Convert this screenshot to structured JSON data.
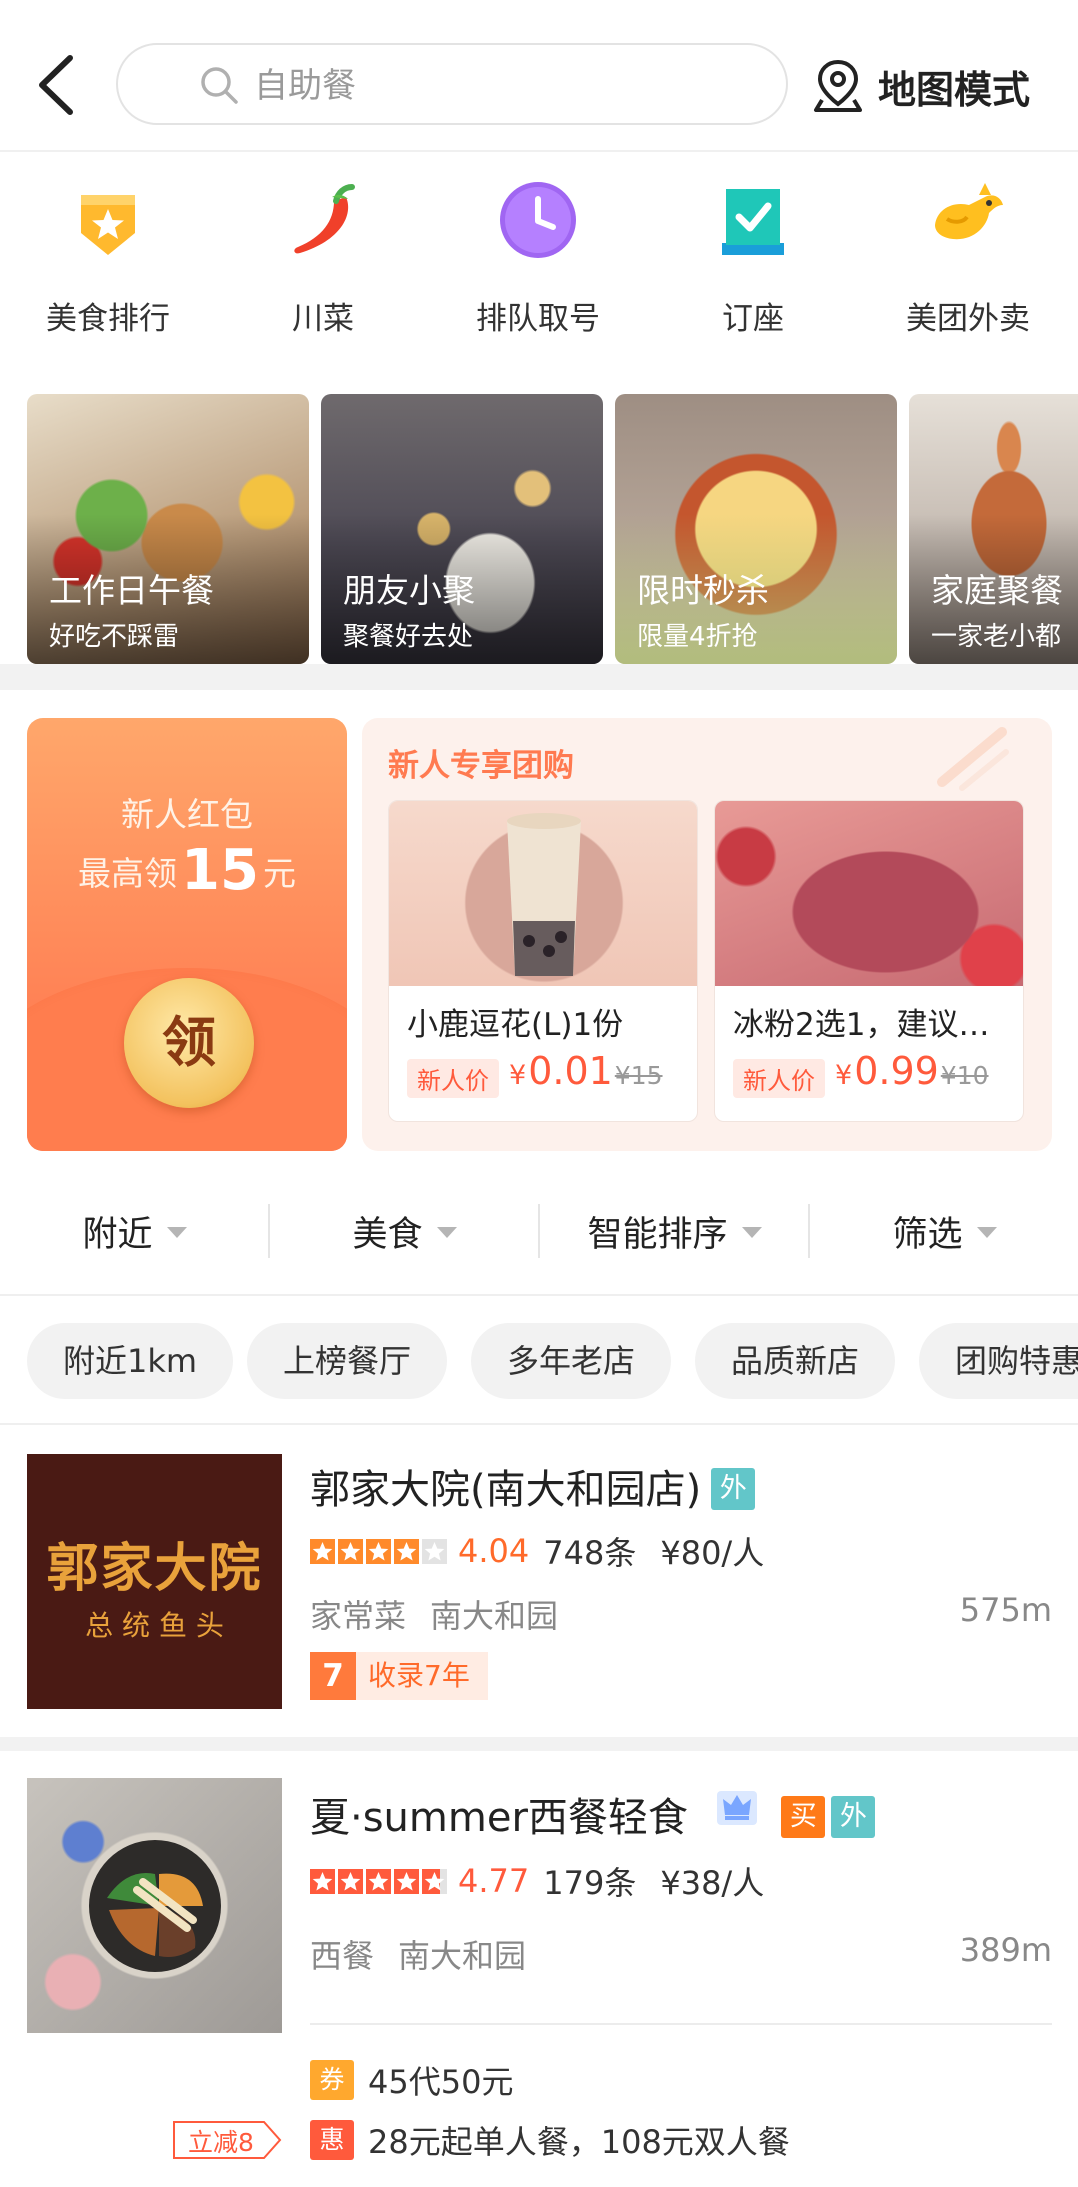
{
  "header": {
    "search_placeholder": "自助餐",
    "map_mode_label": "地图模式"
  },
  "quick_nav": [
    {
      "label": "美食排行",
      "icon": "ranking-badge-icon"
    },
    {
      "label": "川菜",
      "icon": "chili-pepper-icon"
    },
    {
      "label": "排队取号",
      "icon": "clock-icon"
    },
    {
      "label": "订座",
      "icon": "checkmark-seat-icon"
    },
    {
      "label": "美团外卖",
      "icon": "kangaroo-icon"
    }
  ],
  "scenes": [
    {
      "title": "工作日午餐",
      "subtitle": "好吃不踩雷"
    },
    {
      "title": "朋友小聚",
      "subtitle": "聚餐好去处"
    },
    {
      "title": "限时秒杀",
      "subtitle": "限量4折抢"
    },
    {
      "title": "家庭聚餐",
      "subtitle": "一家老小都"
    }
  ],
  "new_user": {
    "redpack_line1": "新人红包",
    "redpack_prefix": "最高领",
    "redpack_amount": "15",
    "redpack_suffix": "元",
    "redpack_button": "领",
    "group_title": "新人专享团购",
    "deals": [
      {
        "name": "小鹿逗花(L)1份",
        "tag": "新人价",
        "yen": "¥",
        "price": "0.01",
        "original": "¥15"
      },
      {
        "name": "冰粉2选1，建议…",
        "tag": "新人价",
        "yen": "¥",
        "price": "0.99",
        "original": "¥10"
      }
    ]
  },
  "filters": [
    "附近",
    "美食",
    "智能排序",
    "筛选"
  ],
  "chips": [
    "附近1km",
    "上榜餐厅",
    "多年老店",
    "品质新店",
    "团购特惠"
  ],
  "restaurants": [
    {
      "name": "郭家大院(南大和园店)",
      "badges": [
        "外"
      ],
      "score": "4.04",
      "reviews": "748条",
      "avg_price": "¥80/人",
      "category": "家常菜",
      "area": "南大和园",
      "distance": "575m",
      "years_num": "7",
      "years_text": "收录7年",
      "logo_line1": "郭家大院",
      "logo_line2": "总 统 鱼 头"
    },
    {
      "name": "夏·summer西餐轻食",
      "badges": [
        "买",
        "外"
      ],
      "score": "4.77",
      "reviews": "179条",
      "avg_price": "¥38/人",
      "category": "西餐",
      "area": "南大和园",
      "distance": "389m",
      "cut_label": "立减8",
      "promos": [
        {
          "badge": "券",
          "text": "45代50元",
          "color": "#ffa82e"
        },
        {
          "badge": "惠",
          "text": "28元起单人餐，108元双人餐",
          "color": "#ff5a3c"
        }
      ]
    }
  ],
  "colors": {
    "accent": "#ff6a2a",
    "teal_badge": "#62c6c9"
  }
}
